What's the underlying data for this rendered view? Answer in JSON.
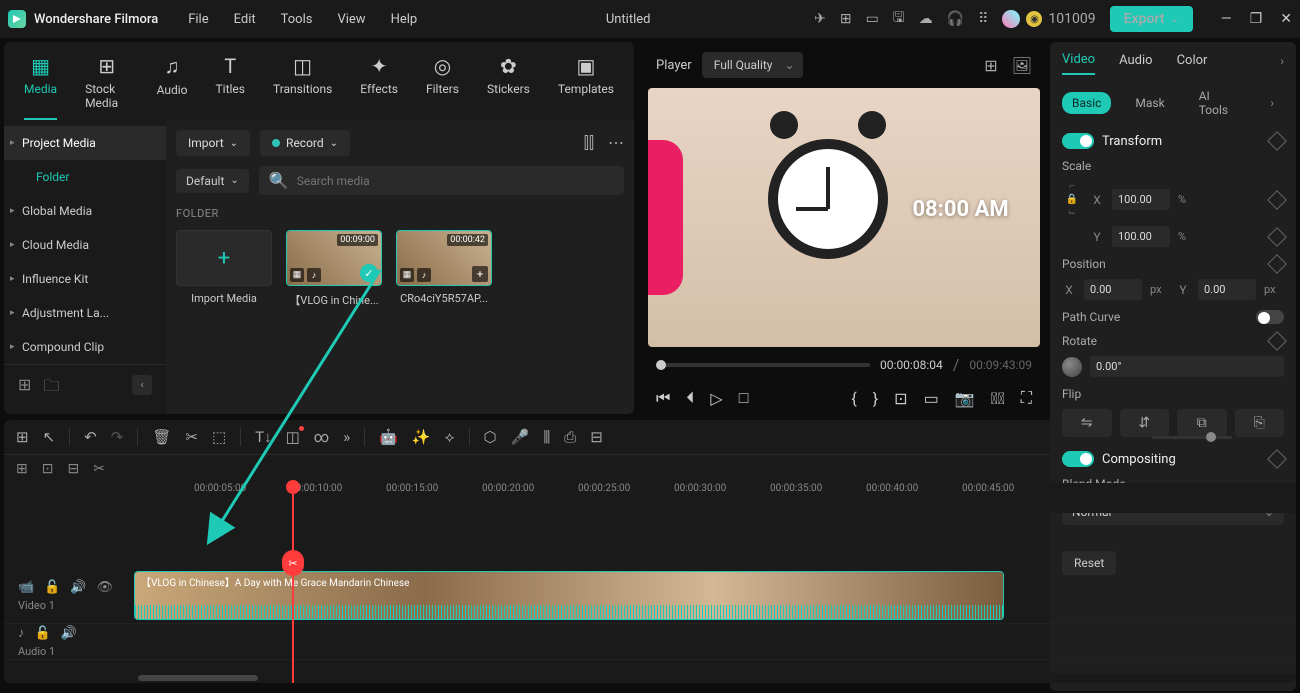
{
  "app": {
    "name": "Wondershare Filmora",
    "doc": "Untitled",
    "credits": "101009",
    "export": "Export"
  },
  "menu": [
    "File",
    "Edit",
    "Tools",
    "View",
    "Help"
  ],
  "tabs": [
    {
      "icon": "▦",
      "label": "Media",
      "active": true
    },
    {
      "icon": "⊞",
      "label": "Stock Media"
    },
    {
      "icon": "♫",
      "label": "Audio"
    },
    {
      "icon": "T",
      "label": "Titles"
    },
    {
      "icon": "◫",
      "label": "Transitions"
    },
    {
      "icon": "✦",
      "label": "Effects"
    },
    {
      "icon": "◎",
      "label": "Filters"
    },
    {
      "icon": "✿",
      "label": "Stickers"
    },
    {
      "icon": "▣",
      "label": "Templates"
    }
  ],
  "sidebar": {
    "items": [
      {
        "label": "Project Media",
        "sel": true
      },
      {
        "label": "Folder",
        "indent": true,
        "active": true
      },
      {
        "label": "Global Media"
      },
      {
        "label": "Cloud Media"
      },
      {
        "label": "Influence Kit"
      },
      {
        "label": "Adjustment La..."
      },
      {
        "label": "Compound Clip"
      }
    ]
  },
  "toolbar": {
    "import": "Import",
    "record": "Record",
    "sort": "Default",
    "search_ph": "Search media",
    "folder_hdr": "FOLDER"
  },
  "thumbs": [
    {
      "kind": "import",
      "label": "Import Media"
    },
    {
      "kind": "clip",
      "dur": "00:09:00",
      "label": "【VLOG in Chine...",
      "checked": true
    },
    {
      "kind": "clip",
      "dur": "00:00:42",
      "label": "CRo4ciY5R57AP..."
    }
  ],
  "preview": {
    "label": "Player",
    "quality": "Full Quality",
    "time_overlay": "08:00 AM",
    "tc_cur": "00:00:08:04",
    "tc_total": "00:09:43:09"
  },
  "props": {
    "tabs": [
      "Video",
      "Audio",
      "Color"
    ],
    "sub_tabs": [
      "Basic",
      "Mask",
      "AI Tools"
    ],
    "transform": "Transform",
    "scale": "Scale",
    "scale_x": "100.00",
    "scale_y": "100.00",
    "position": "Position",
    "pos_x": "0.00",
    "pos_y": "0.00",
    "path": "Path Curve",
    "rotate": "Rotate",
    "rot_val": "0.00°",
    "flip": "Flip",
    "comp": "Compositing",
    "blend": "Blend Mode",
    "blend_val": "Normal",
    "reset": "Reset"
  },
  "timeline": {
    "marks": [
      "00:00:05:00",
      "00:00:10:00",
      "00:00:15:00",
      "00:00:20:00",
      "00:00:25:00",
      "00:00:30:00",
      "00:00:35:00",
      "00:00:40:00",
      "00:00:45:00"
    ],
    "video_track": "Video 1",
    "audio_track": "Audio 1",
    "clip_label": "【VLOG in Chinese】A Day with Me    Grace Mandarin Chinese"
  }
}
